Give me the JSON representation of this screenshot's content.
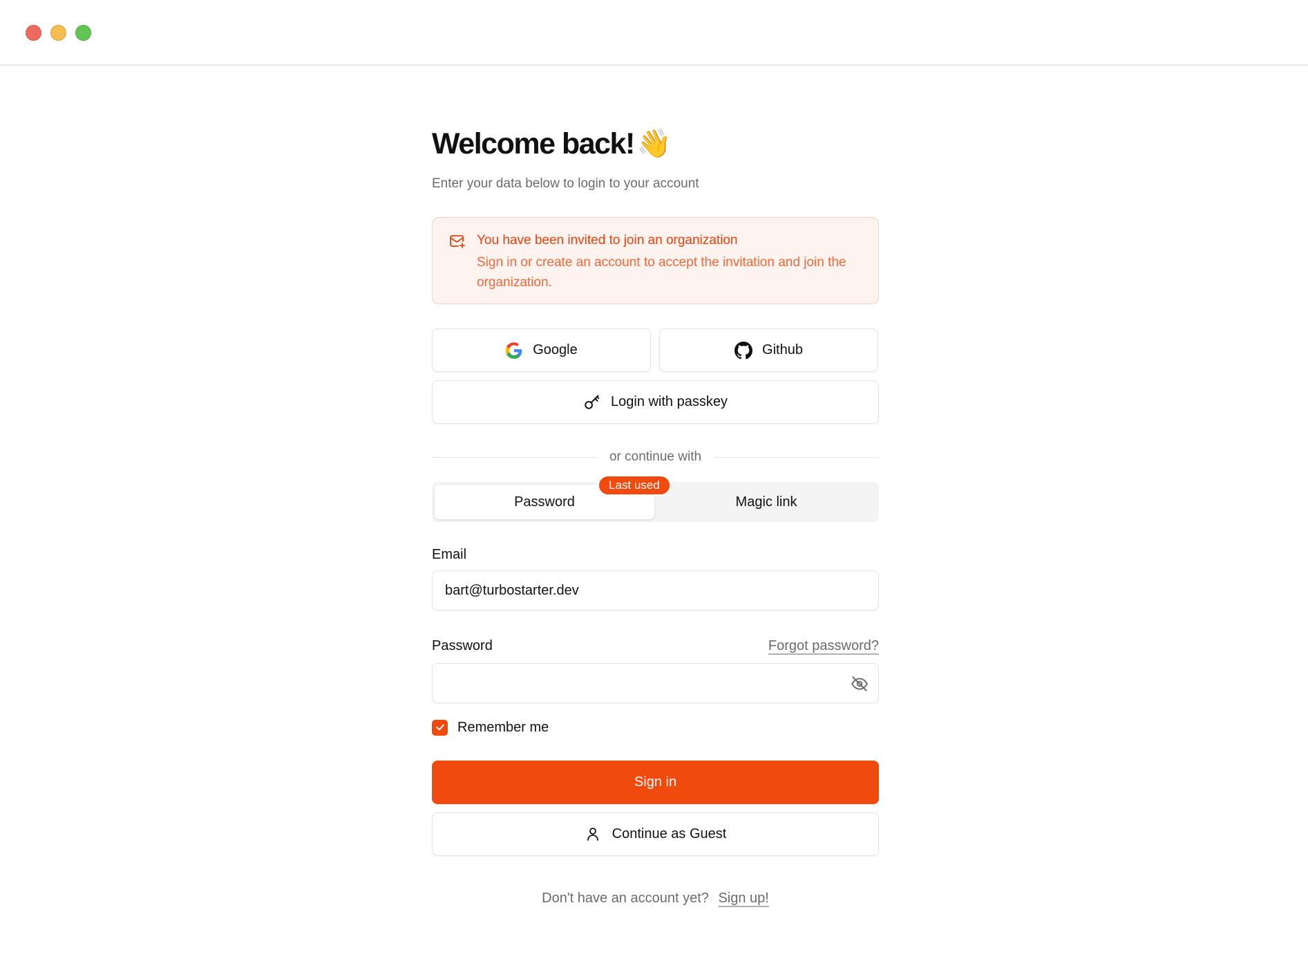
{
  "window": {
    "controls": [
      "close",
      "minimize",
      "maximize"
    ]
  },
  "header": {
    "title": "Welcome back!",
    "emoji": "👋",
    "subtitle": "Enter your data below to login to your account"
  },
  "invite": {
    "icon": "mail-plus-icon",
    "title": "You have been invited to join an organization",
    "body": "Sign in or create an account to accept the invitation and join the organization."
  },
  "social": {
    "google_label": "Google",
    "github_label": "Github",
    "passkey_label": "Login with passkey"
  },
  "divider": {
    "text": "or continue with"
  },
  "tabs": {
    "items": [
      {
        "label": "Password",
        "active": true
      },
      {
        "label": "Magic link",
        "active": false
      }
    ],
    "badge": "Last used"
  },
  "form": {
    "email_label": "Email",
    "email_value": "bart@turbostarter.dev",
    "password_label": "Password",
    "forgot_label": "Forgot password?",
    "password_value": "",
    "remember_label": "Remember me",
    "remember_checked": true
  },
  "actions": {
    "sign_in": "Sign in",
    "guest": "Continue as Guest"
  },
  "footer": {
    "prompt": "Don't have an account yet?",
    "link": "Sign up!"
  },
  "colors": {
    "accent": "#f14a0f",
    "alert_bg": "#fff3f0",
    "alert_text": "#e8420c"
  }
}
